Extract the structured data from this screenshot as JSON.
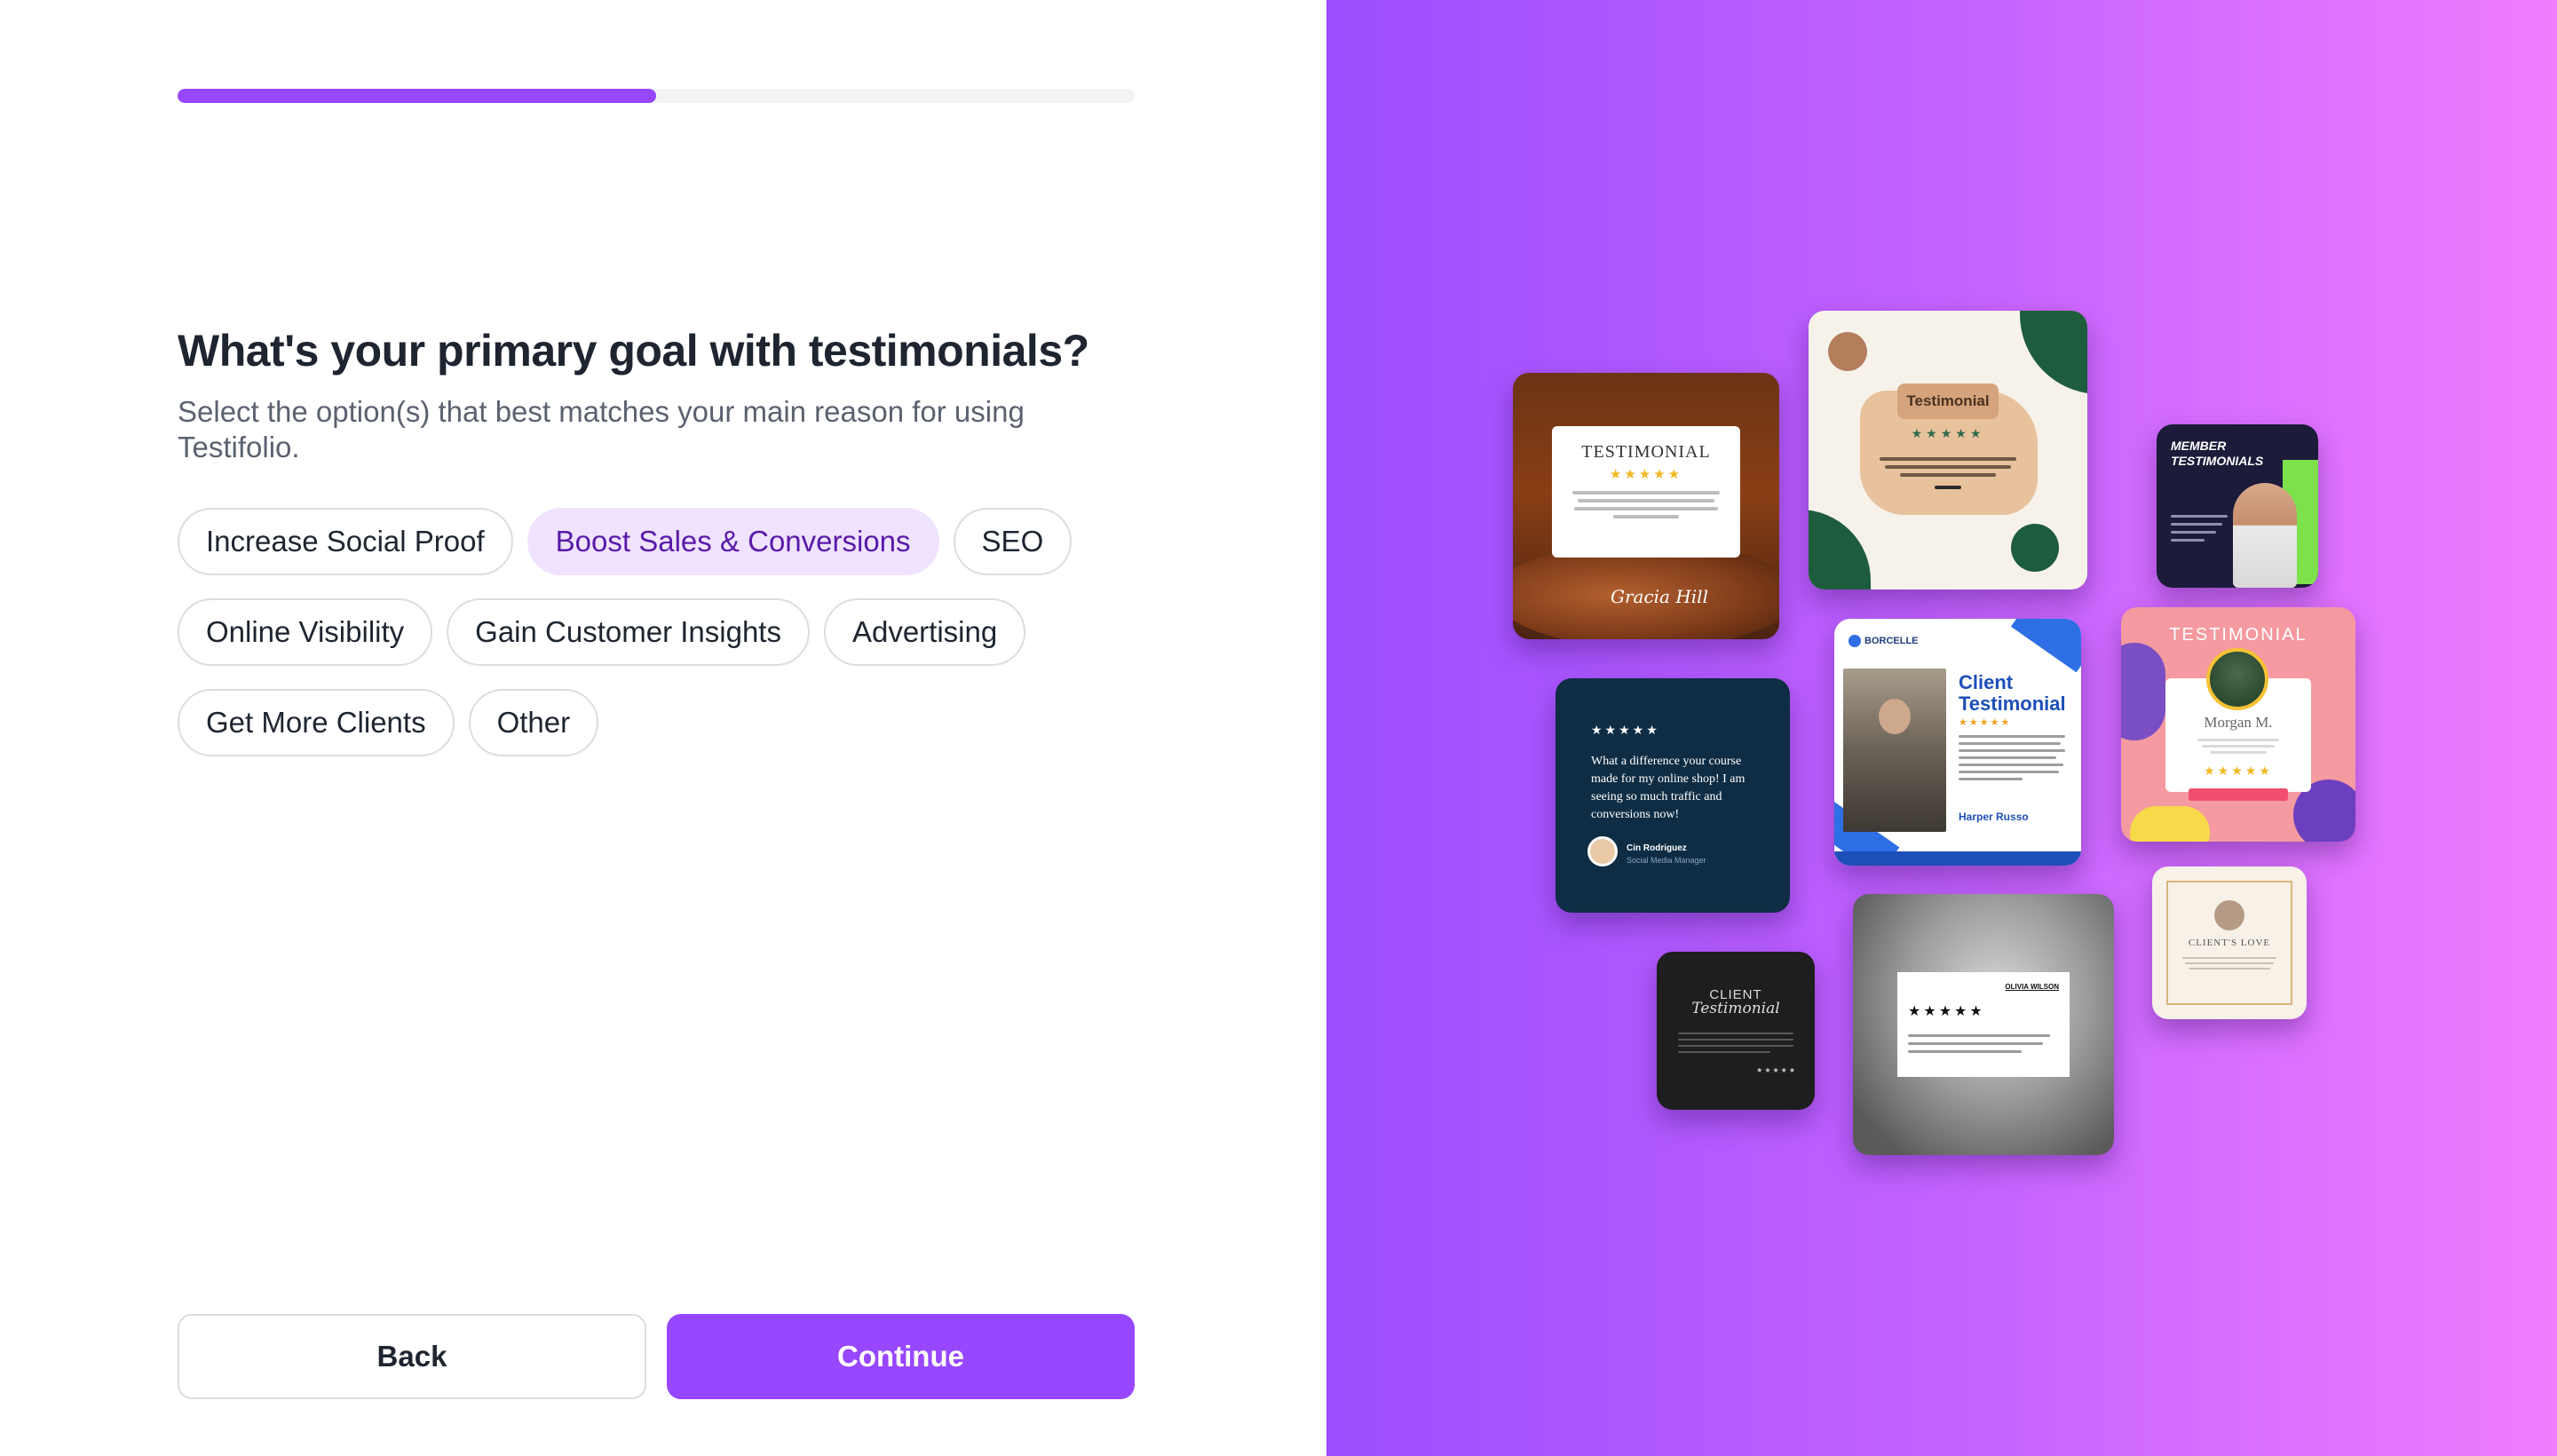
{
  "progress": {
    "fraction": 0.5
  },
  "question": {
    "title": "What's your primary goal with testimonials?",
    "subtitle": "Select the option(s) that best matches your main reason for using Testifolio."
  },
  "options": [
    {
      "label": "Increase Social Proof",
      "selected": false
    },
    {
      "label": "Boost Sales & Conversions",
      "selected": true
    },
    {
      "label": "SEO",
      "selected": false
    },
    {
      "label": "Online Visibility",
      "selected": false
    },
    {
      "label": "Gain Customer Insights",
      "selected": false
    },
    {
      "label": "Advertising",
      "selected": false
    },
    {
      "label": "Get More Clients",
      "selected": false
    },
    {
      "label": "Other",
      "selected": false
    }
  ],
  "buttons": {
    "back": "Back",
    "continue": "Continue"
  },
  "colors": {
    "accent": "#9747ff",
    "selected_chip_bg": "#efe3ff",
    "selected_chip_text": "#5a1aa8",
    "panel_gradient_start": "#9b4dff",
    "panel_gradient_end": "#f07cff"
  },
  "gallery": {
    "card_food": {
      "title": "TESTIMONIAL",
      "stars": "★★★★★",
      "signature": "Gracia Hill"
    },
    "card_beige": {
      "title": "Testimonial",
      "stars": "★★★★★"
    },
    "card_member": {
      "title": "MEMBER TESTIMONIALS"
    },
    "card_navy": {
      "stars": "★★★★★",
      "quote": "What a difference your course made for my online shop! I am seeing so much traffic and conversions now!",
      "name": "Cin Rodriguez",
      "role": "Social Media Manager"
    },
    "card_borcelle": {
      "brand": "BORCELLE",
      "title": "Client Testimonial",
      "stars": "★★★★★",
      "name": "Harper Russo"
    },
    "card_pink": {
      "title": "TESTIMONIAL",
      "name": "Morgan M.",
      "stars": "★★★★★"
    },
    "card_black": {
      "title_top": "CLIENT",
      "title_bottom": "Testimonial",
      "stars": "★★★★★"
    },
    "card_bw": {
      "name": "OLIVIA WILSON",
      "stars": "★★★★★"
    },
    "card_love": {
      "title": "CLIENT'S LOVE"
    }
  }
}
